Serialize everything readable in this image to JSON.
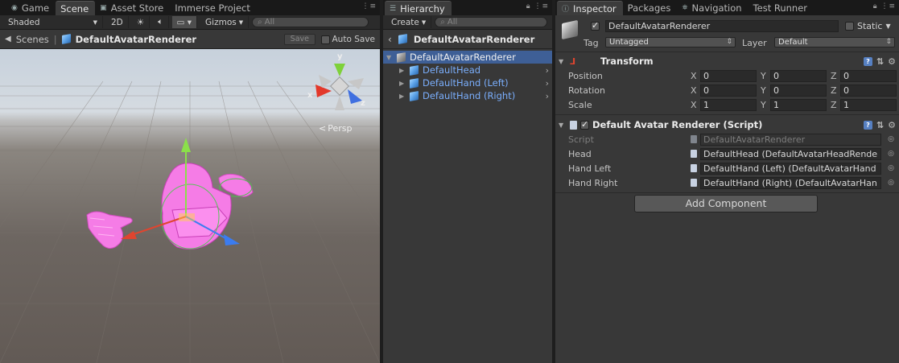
{
  "scene_panel": {
    "tabs": [
      {
        "label": "Game",
        "icon": "game-icon"
      },
      {
        "label": "Scene",
        "icon": "scene-icon"
      },
      {
        "label": "Asset Store",
        "icon": "asset-store-icon"
      },
      {
        "label": "Immerse Project",
        "icon": "project-icon"
      }
    ],
    "toolbar": {
      "shading_mode": "Shaded",
      "mode_2d": "2D",
      "gizmos_label": "Gizmos",
      "search_placeholder": "All"
    },
    "breadcrumb": {
      "root": "Scenes",
      "current": "DefaultAvatarRenderer"
    },
    "save_label": "Save",
    "autosave_label": "Auto Save",
    "autosave_checked": false,
    "viewport": {
      "axis_x": "x",
      "axis_y": "y",
      "axis_z": "z",
      "projection": "Persp"
    }
  },
  "hierarchy": {
    "tab_label": "Hierarchy",
    "create_label": "Create",
    "search_placeholder": "All",
    "title": "DefaultAvatarRenderer",
    "items": [
      {
        "label": "DefaultAvatarRenderer",
        "selected": true
      },
      {
        "label": "DefaultHead"
      },
      {
        "label": "DefaultHand (Left)"
      },
      {
        "label": "DefaultHand (Right)"
      }
    ]
  },
  "inspector": {
    "tabs": [
      {
        "label": "Inspector",
        "icon": "info-icon"
      },
      {
        "label": "Packages"
      },
      {
        "label": "Navigation",
        "icon": "navigation-icon"
      },
      {
        "label": "Test Runner"
      }
    ],
    "object_name": "DefaultAvatarRenderer",
    "active": true,
    "static_label": "Static",
    "tag_label": "Tag",
    "tag_value": "Untagged",
    "layer_label": "Layer",
    "layer_value": "Default",
    "transform": {
      "title": "Transform",
      "rows": [
        {
          "label": "Position",
          "x": "0",
          "y": "0",
          "z": "0"
        },
        {
          "label": "Rotation",
          "x": "0",
          "y": "0",
          "z": "0"
        },
        {
          "label": "Scale",
          "x": "1",
          "y": "1",
          "z": "1"
        }
      ],
      "axis_labels": {
        "x": "X",
        "y": "Y",
        "z": "Z"
      }
    },
    "script_component": {
      "title": "Default Avatar Renderer (Script)",
      "enabled": true,
      "rows": [
        {
          "label": "Script",
          "value": "DefaultAvatarRenderer",
          "disabled": true
        },
        {
          "label": "Head",
          "value": "DefaultHead (DefaultAvatarHeadRende"
        },
        {
          "label": "Hand Left",
          "value": "DefaultHand (Left) (DefaultAvatarHand"
        },
        {
          "label": "Hand Right",
          "value": "DefaultHand (Right) (DefaultAvatarHan"
        }
      ]
    },
    "add_component_label": "Add Component"
  },
  "colors": {
    "selection": "#3e5f96",
    "hierarchy_link": "#7aaefc",
    "avatar_pink": "#ff6ce8"
  }
}
